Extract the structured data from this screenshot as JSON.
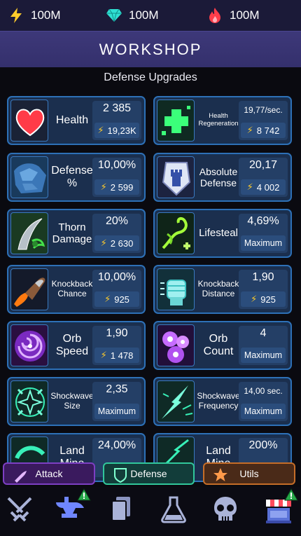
{
  "currencies": {
    "coins": "100M",
    "gems": "100M",
    "medals": "100M"
  },
  "title": "WORKSHOP",
  "section_title": "Defense Upgrades",
  "upgrades": [
    {
      "name": "Health",
      "value": "2 385",
      "cost": "19,23K",
      "maxed": false
    },
    {
      "name": "Health Regeneration",
      "value": "19,77/sec.",
      "cost": "8 742",
      "maxed": false
    },
    {
      "name": "Defense %",
      "value": "10,00%",
      "cost": "2 599",
      "maxed": false
    },
    {
      "name": "Absolute Defense",
      "value": "20,17",
      "cost": "4 002",
      "maxed": false
    },
    {
      "name": "Thorn Damage",
      "value": "20%",
      "cost": "2 630",
      "maxed": false
    },
    {
      "name": "Lifesteal",
      "value": "4,69%",
      "cost": "Maximum",
      "maxed": true
    },
    {
      "name": "Knockback Chance",
      "value": "10,00%",
      "cost": "925",
      "maxed": false
    },
    {
      "name": "Knockback Distance",
      "value": "1,90",
      "cost": "925",
      "maxed": false
    },
    {
      "name": "Orb Speed",
      "value": "1,90",
      "cost": "1 478",
      "maxed": false
    },
    {
      "name": "Orb Count",
      "value": "4",
      "cost": "Maximum",
      "maxed": true
    },
    {
      "name": "Shockwave Size",
      "value": "2,35",
      "cost": "Maximum",
      "maxed": true
    },
    {
      "name": "Shockwave Frequency",
      "value": "14,00 sec.",
      "cost": "Maximum",
      "maxed": true
    },
    {
      "name": "Land Mine",
      "value": "24,00%",
      "cost": "",
      "maxed": false
    },
    {
      "name": "Land Mine",
      "value": "200%",
      "cost": "",
      "maxed": false
    }
  ],
  "tabs": {
    "attack": "Attack",
    "defense": "Defense",
    "utils": "Utils",
    "active": "defense"
  },
  "nav": [
    "battle-swords-icon",
    "anvil-icon",
    "cards-icon",
    "flask-icon",
    "skull-icon",
    "shop-icon"
  ],
  "colors": {
    "card_border": "#2e70b6",
    "attack_tab": "#7d3fc3",
    "defense_tab": "#31c79b",
    "utils_tab": "#c56d28",
    "coin": "#ffcc2b"
  }
}
